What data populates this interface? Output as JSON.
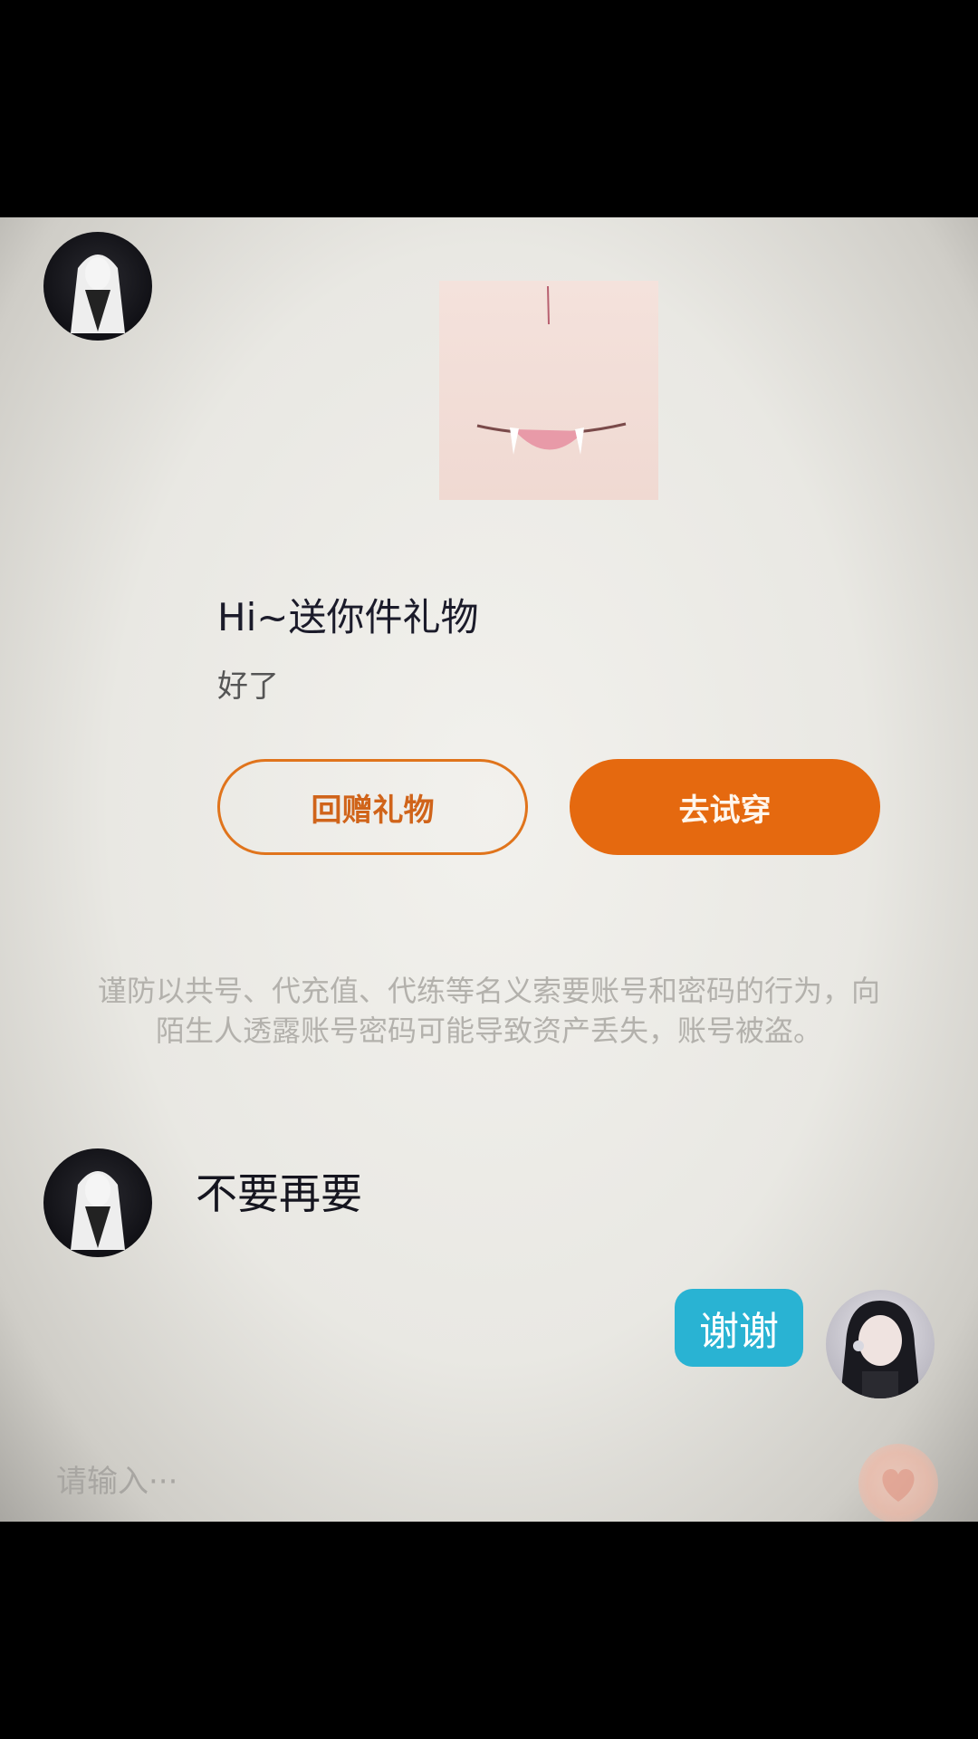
{
  "chat": {
    "gift_card": {
      "title": "Hi~送你件礼物",
      "message": "好了",
      "return_gift_label": "回赠礼物",
      "try_on_label": "去试穿"
    },
    "security_notice": "谨防以共号、代充值、代练等名义索要账号和密码的行为，向陌生人透露账号密码可能导致资产丢失，账号被盗。",
    "messages": [
      {
        "sender": "other",
        "text": "不要再要"
      },
      {
        "sender": "me",
        "text": "谢谢"
      }
    ]
  },
  "input": {
    "placeholder": "请输入···"
  },
  "icons": {
    "send": "gift-send-icon"
  },
  "colors": {
    "accent_orange": "#e5690f",
    "bubble_blue": "#29b3d3"
  }
}
